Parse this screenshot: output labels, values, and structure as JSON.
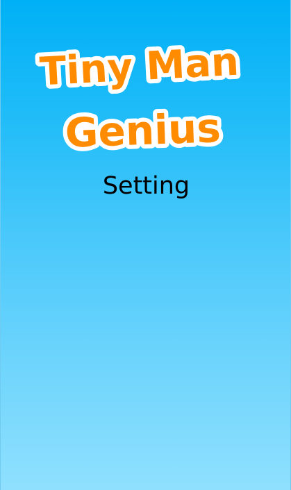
{
  "game": {
    "title_line1": "Tiny Man",
    "title_line2": "Genius"
  },
  "screen": {
    "title": "Setting"
  },
  "colors": {
    "logo_fill": "#ff8c00",
    "logo_outline": "#ffffff",
    "background_top": "#00b0f6",
    "background_bottom": "#8fe0fe",
    "title_text": "#000000"
  }
}
